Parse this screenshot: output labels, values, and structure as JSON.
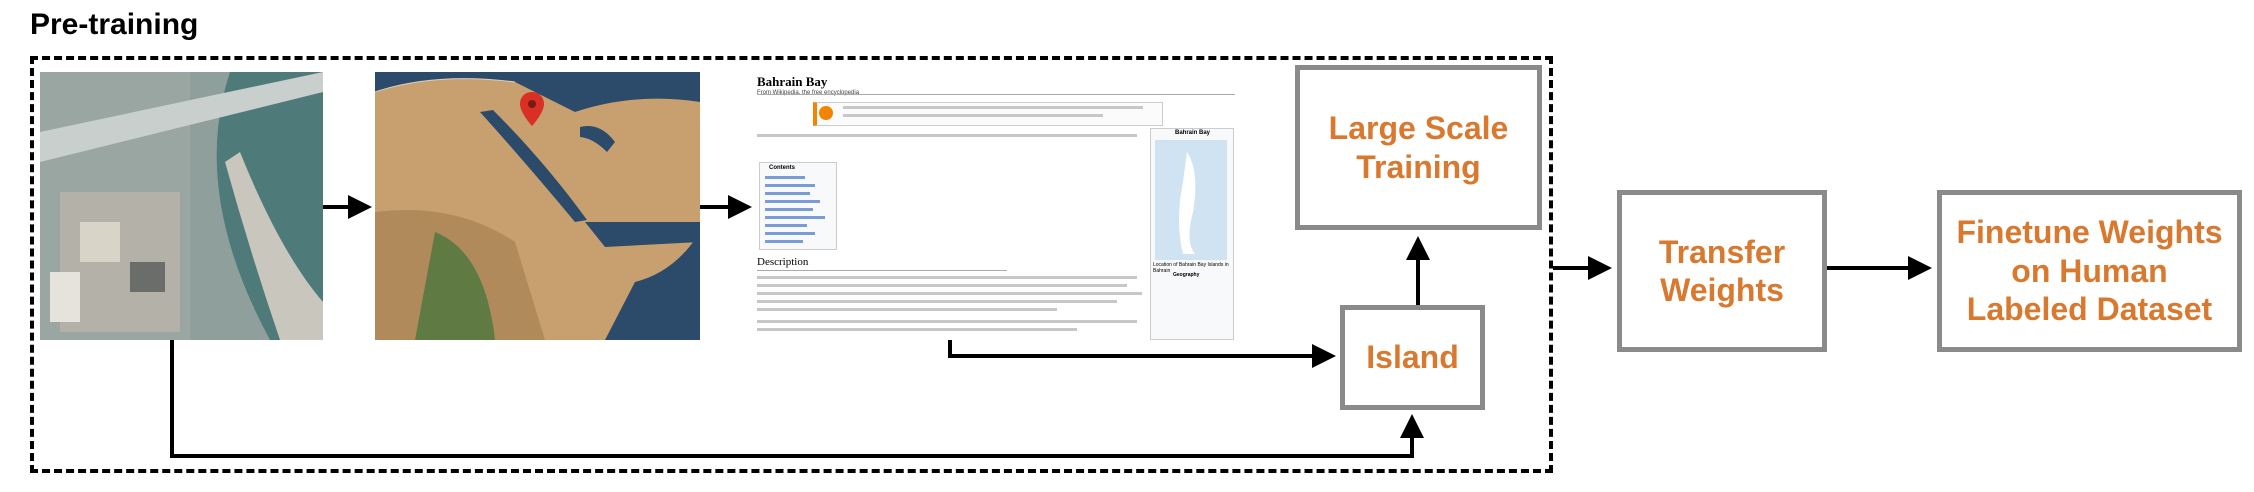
{
  "header": {
    "title": "Pre-training"
  },
  "wiki": {
    "title": "Bahrain Bay",
    "subtitle": "From Wikipedia, the free encyclopedia",
    "infobox_title": "Bahrain Bay",
    "contents_title": "Contents",
    "section": "Description",
    "infobox_caption": "Location of Bahrain Bay Islands in Bahrain",
    "infobox_geo": "Geography"
  },
  "boxes": {
    "large_scale": "Large Scale\nTraining",
    "island": "Island",
    "transfer": "Transfer\nWeights",
    "finetune": "Finetune Weights\non Human\nLabeled Dataset"
  },
  "colors": {
    "accent": "#d8792f",
    "box_border": "#8a8a8a",
    "arrow": "#000000"
  }
}
